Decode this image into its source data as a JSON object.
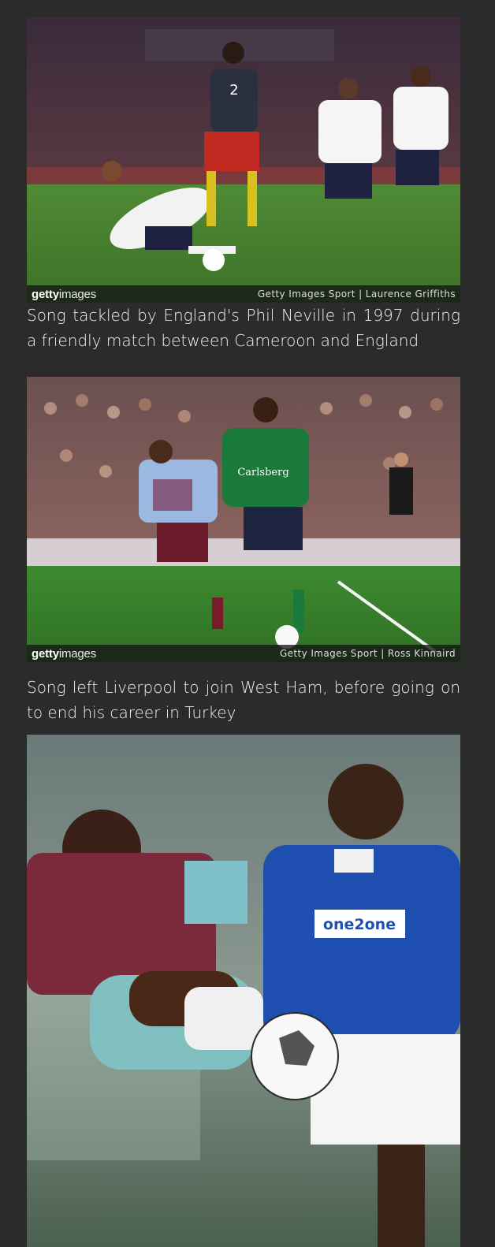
{
  "articles": [
    {
      "credit": "Getty Images Sport | Laurence Griffiths",
      "caption": "Song tackled by England's Phil Neville in 1997 during a friendly match between Cameroon and England"
    },
    {
      "credit": "Getty Images Sport | Ross Kinnaird",
      "caption": "Song left Liverpool to join West Ham, before going on to end his career in Turkey"
    },
    {
      "credit": "",
      "caption": ""
    }
  ],
  "brand": {
    "getty_bold": "getty",
    "getty_light": "images"
  },
  "colors": {
    "background": "#2b2b2b",
    "caption_text": "#f2f2f2",
    "pitch_green": "#3f7a2e"
  }
}
